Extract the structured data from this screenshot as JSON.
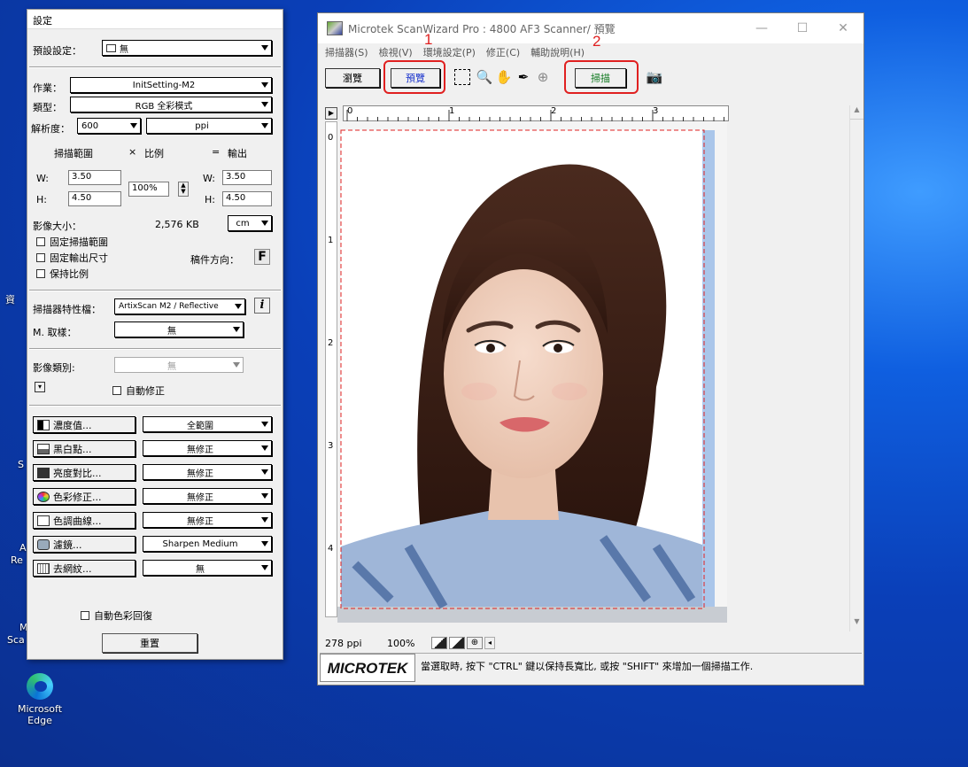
{
  "desktop": {
    "edge_label_1": "Microsoft",
    "edge_label_2": "Edge",
    "partial_labels": [
      "資",
      "S",
      "A",
      "Re",
      "M",
      "Sca"
    ]
  },
  "settings": {
    "title": "設定",
    "preset_label": "預設設定：",
    "preset_value": "無",
    "job_label": "作業：",
    "job_value": "InitSetting-M2",
    "type_label": "類型：",
    "type_value": "RGB 全彩模式",
    "res_label": "解析度：",
    "res_value": "600",
    "res_unit": "ppi",
    "scan_area": "掃描範圍",
    "times": "×",
    "scale": "比例",
    "equals": "=",
    "output": "輸出",
    "w_label": "W:",
    "h_label": "H:",
    "in_w": "3.50",
    "in_h": "4.50",
    "scale_value": "100%",
    "out_w": "3.50",
    "out_h": "4.50",
    "size_label": "影像大小：",
    "size_value": "2,576 KB",
    "size_unit": "cm",
    "fix_area": "固定掃描範圍",
    "fix_output": "固定輸出尺寸",
    "keep_ratio": "保持比例",
    "orient_label": "稿件方向：",
    "orient_value": "F",
    "profile_label": "掃描器特性檔：",
    "profile_value": "ArtixScan M2 / Reflective",
    "info": "i",
    "sample_label": "M. 取樣：",
    "sample_value": "無",
    "imgtype_label": "影像類別:",
    "imgtype_value": "無",
    "auto_correct": "自動修正",
    "adjust": [
      {
        "label": "濃度值...",
        "value": "全範圍"
      },
      {
        "label": "黑白點...",
        "value": "無修正"
      },
      {
        "label": "亮度對比...",
        "value": "無修正"
      },
      {
        "label": "色彩修正...",
        "value": "無修正"
      },
      {
        "label": "色調曲線...",
        "value": "無修正"
      },
      {
        "label": "濾鏡...",
        "value": "Sharpen Medium"
      },
      {
        "label": "去網紋...",
        "value": "無"
      }
    ],
    "auto_color": "自動色彩回復",
    "reset": "重置"
  },
  "scanner": {
    "title": "Microtek ScanWizard Pro : 4800 AF3 Scanner/ 預覽",
    "menu": [
      "掃描器(S)",
      "檢視(V)",
      "環境設定(P)",
      "修正(C)",
      "輔助說明(H)"
    ],
    "browse": "瀏覽",
    "preview": "預覽",
    "scan": "掃描",
    "anno1": "1",
    "anno2": "2",
    "ruler_h": [
      "0",
      "1",
      "2",
      "3"
    ],
    "ruler_v": [
      "0",
      "1",
      "2",
      "3",
      "4"
    ],
    "status_ppi": "278 ppi",
    "status_zoom": "100%",
    "logo": "MICROTEK",
    "hint": "當選取時, 按下 \"CTRL\" 鍵以保持長寬比, 或按 \"SHIFT\" 來增加一個掃描工作."
  },
  "colors": {
    "highlight": "#e02020",
    "preview_text": "#1a33cc",
    "scan_text": "#127a22"
  }
}
